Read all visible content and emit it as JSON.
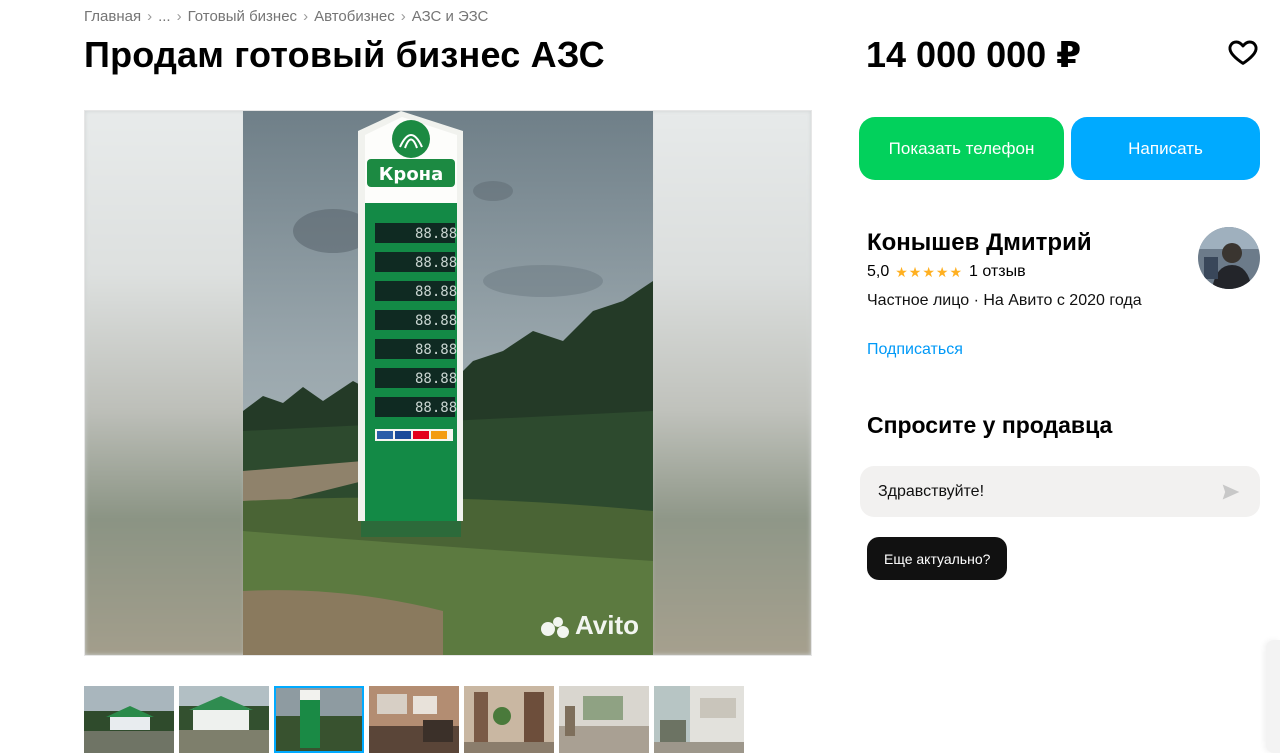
{
  "breadcrumb": [
    "Главная",
    "...",
    "Готовый бизнес",
    "Автобизнес",
    "АЗС и ЭЗС"
  ],
  "listing": {
    "title": "Продам готовый бизнес АЗС",
    "price": "14 000 000 ₽"
  },
  "photo": {
    "sign_brand": "Крона",
    "price_digits": "88.88",
    "watermark": "Avito"
  },
  "actions": {
    "show_phone": "Показать телефон",
    "write": "Написать"
  },
  "seller": {
    "name": "Конышев Дмитрий",
    "rating": "5,0",
    "stars": "★★★★★",
    "reviews": "1 отзыв",
    "type": "Частное лицо · На Авито с 2020 года",
    "subscribe": "Подписаться"
  },
  "ask": {
    "title": "Спросите у продавца",
    "message": "Здравствуйте!",
    "quick_reply": "Еще актуально?"
  },
  "colors": {
    "green": "#02d15c",
    "blue": "#00aaff",
    "link": "#0099f7",
    "star": "#ffb021"
  },
  "thumbnails": [
    "thumb-1",
    "thumb-2",
    "thumb-3",
    "thumb-4",
    "thumb-5",
    "thumb-6",
    "thumb-7"
  ]
}
